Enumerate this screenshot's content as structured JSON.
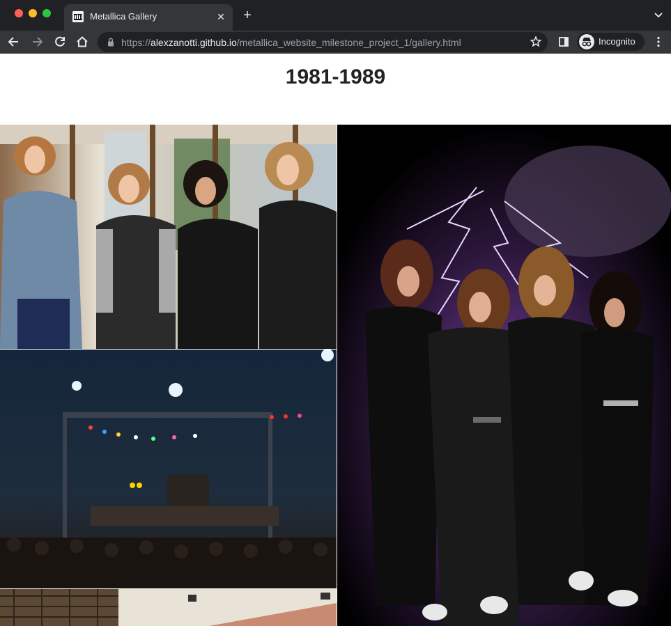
{
  "browser": {
    "tab_title": "Metallica Gallery",
    "tab_close_glyph": "✕",
    "new_tab_glyph": "+",
    "url_scheme": "https://",
    "url_host": "alexzanotti.github.io",
    "url_path": "/metallica_website_milestone_project_1/gallery.html",
    "profile_label": "Incognito",
    "icons": [
      "back-icon",
      "forward-icon",
      "reload-icon",
      "home-icon",
      "lock-icon",
      "star-icon",
      "side-panel-icon",
      "incognito-icon",
      "menu-icon",
      "tab-search-icon"
    ]
  },
  "page": {
    "heading": "1981-1989"
  },
  "gallery": {
    "images": [
      {
        "name": "band-photo-window"
      },
      {
        "name": "concert-stage-photo"
      },
      {
        "name": "stadium-photo"
      },
      {
        "name": "band-photo-lightning"
      }
    ]
  },
  "colors": {
    "chrome_dark": "#202124",
    "chrome_tab": "#35363a",
    "heading_text": "#222222"
  }
}
